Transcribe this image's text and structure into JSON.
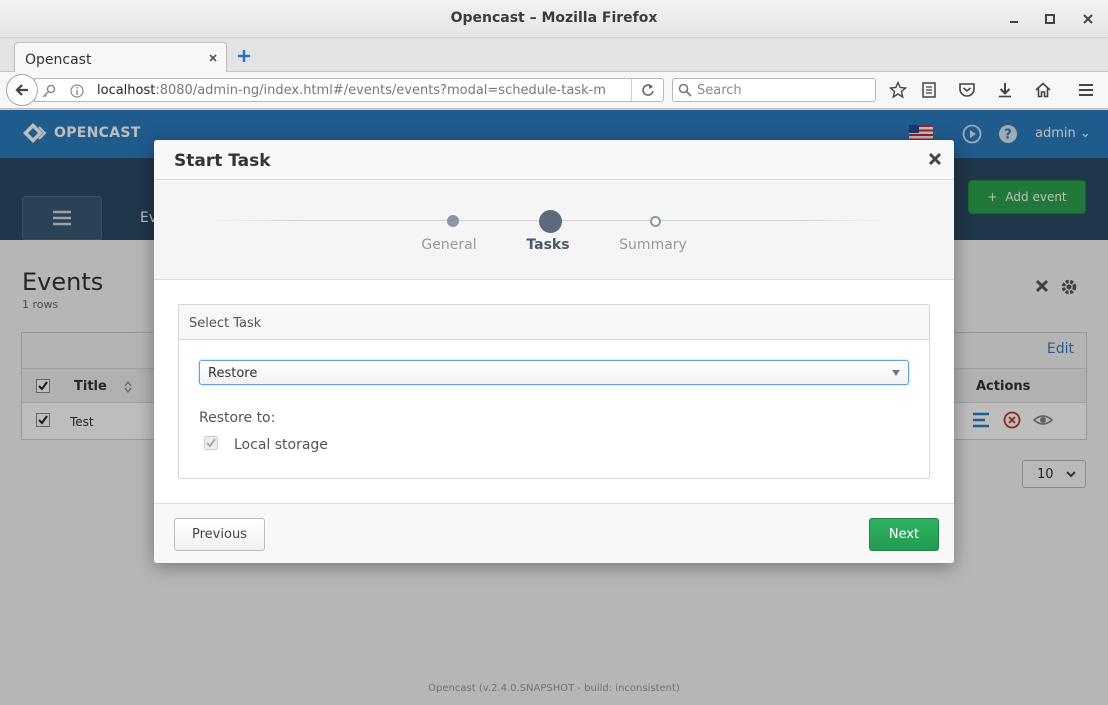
{
  "browser": {
    "window_title": "Opencast – Mozilla Firefox",
    "tab_title": "Opencast",
    "url_host": "localhost",
    "url_rest": ":8080/admin-ng/index.html#/events/events?modal=schedule-task-m",
    "search_placeholder": "Search"
  },
  "app": {
    "logo_text": "OPENCAST",
    "user": "admin",
    "subnav_label": "Ev",
    "add_event_label": "Add event",
    "page_title": "Events",
    "row_count": "1 rows",
    "edit_label": "Edit",
    "columns": {
      "title": "Title",
      "actions": "Actions"
    },
    "rows": [
      {
        "title": "Test"
      }
    ],
    "page_size": "10",
    "footer": "Opencast (v.2.4.0.SNAPSHOT - build: inconsistent)"
  },
  "modal": {
    "title": "Start Task",
    "steps": [
      {
        "label": "General",
        "state": "done"
      },
      {
        "label": "Tasks",
        "state": "active"
      },
      {
        "label": "Summary",
        "state": "todo"
      }
    ],
    "panel_title": "Select Task",
    "selected_task": "Restore",
    "restore_to_label": "Restore to:",
    "storage_option": "Local storage",
    "storage_checked": true,
    "previous_label": "Previous",
    "next_label": "Next"
  },
  "colors": {
    "header_blue": "#2c7bbf",
    "subnav_dark": "#2c4a63",
    "primary_green": "#2da44e"
  }
}
